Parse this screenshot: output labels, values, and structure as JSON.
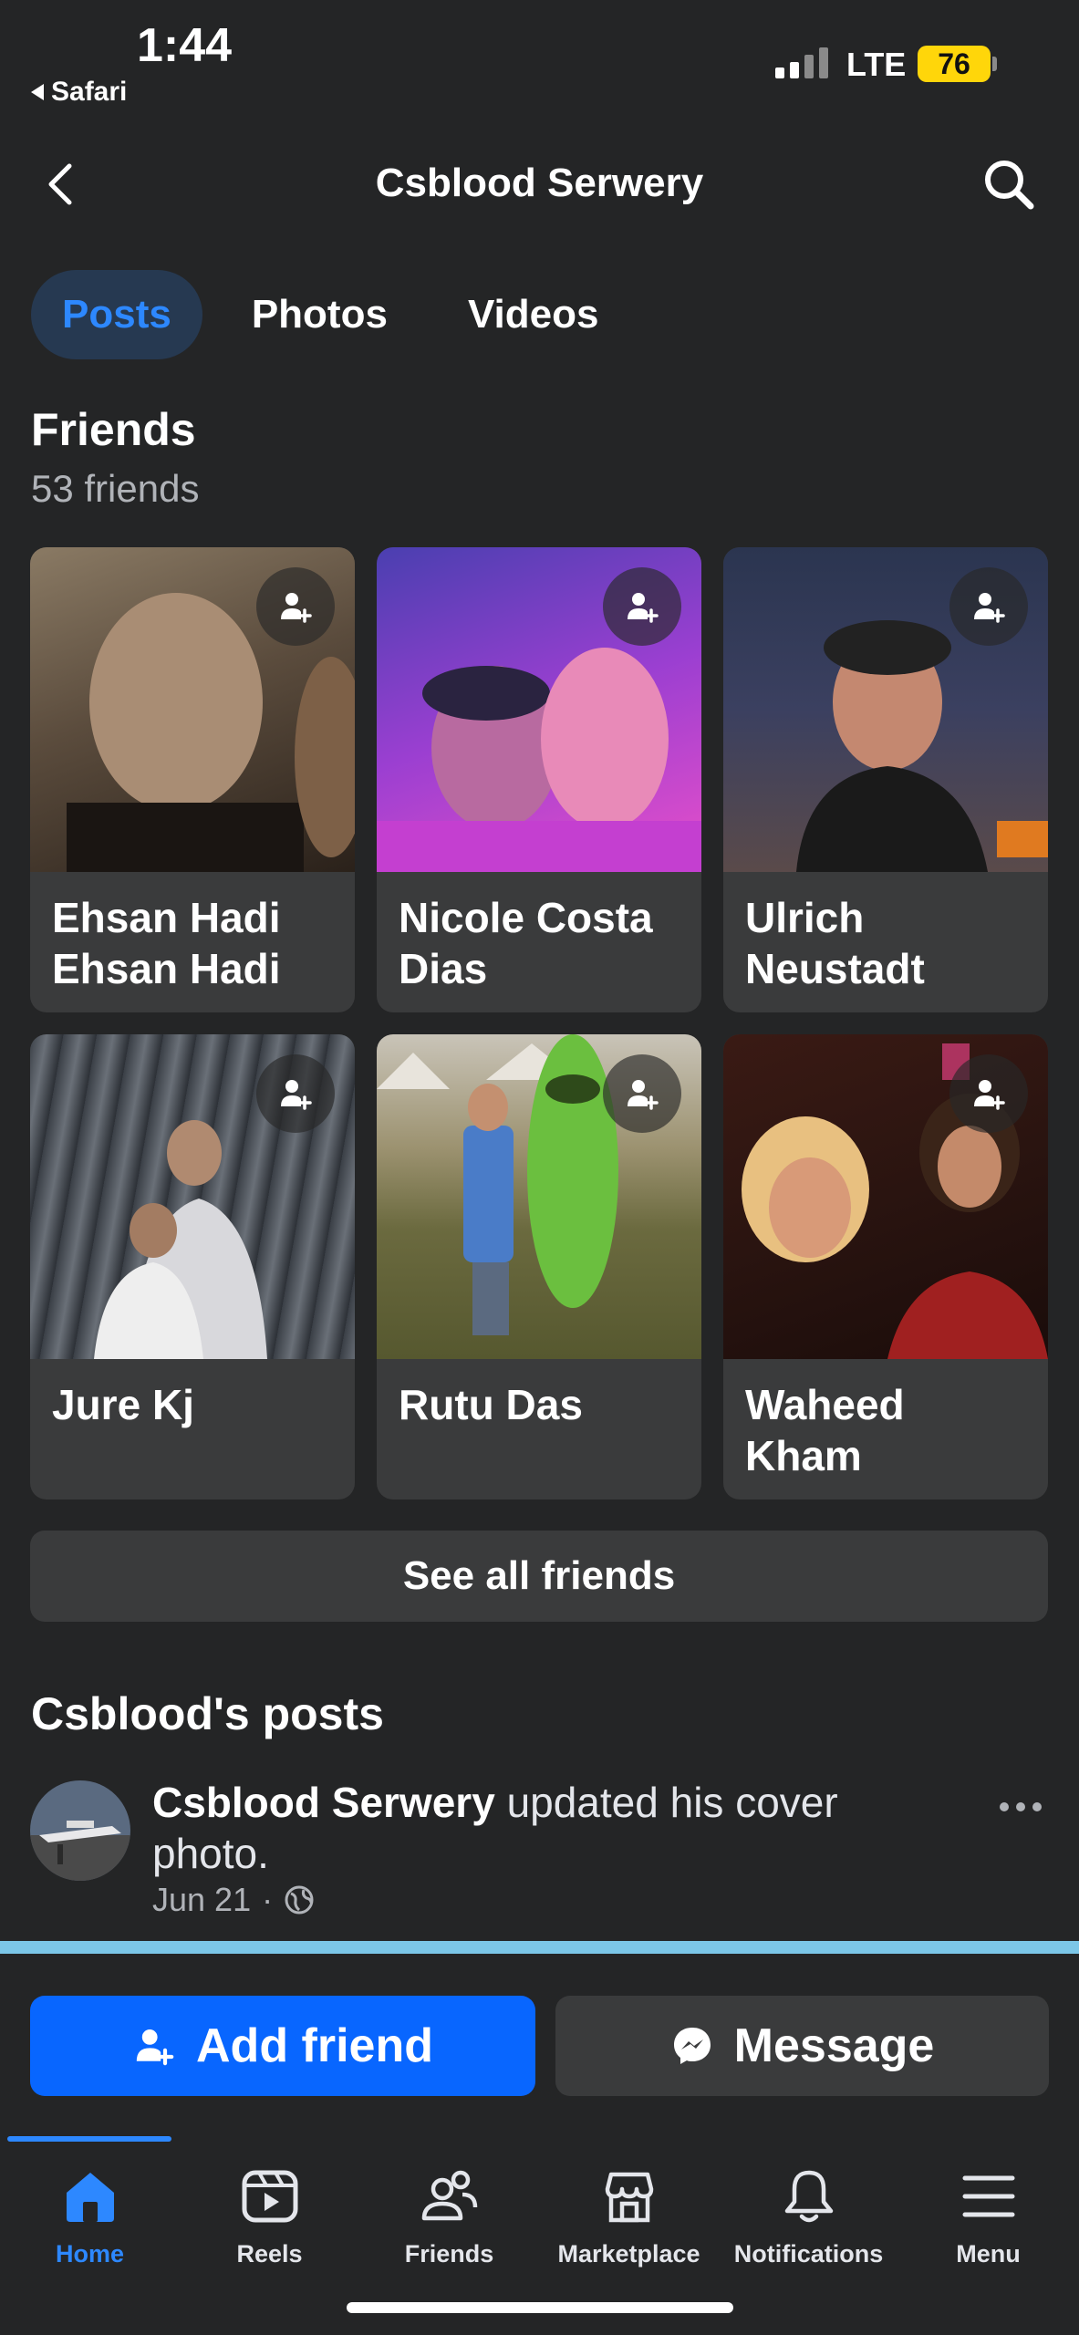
{
  "status": {
    "time": "1:44",
    "back_app": "Safari",
    "network": "LTE",
    "battery": "76"
  },
  "header": {
    "title": "Csblood Serwery"
  },
  "tabs": [
    {
      "label": "Posts",
      "active": true
    },
    {
      "label": "Photos",
      "active": false
    },
    {
      "label": "Videos",
      "active": false
    }
  ],
  "friends": {
    "title": "Friends",
    "count": "53 friends",
    "items": [
      {
        "name": "Ehsan Hadi Ehsan Hadi"
      },
      {
        "name": "Nicole Costa Dias"
      },
      {
        "name": "Ulrich Neustadt"
      },
      {
        "name": "Jure Kj"
      },
      {
        "name": "Rutu Das"
      },
      {
        "name": "Waheed Kham"
      }
    ],
    "see_all": "See all friends"
  },
  "posts": {
    "title": "Csblood's posts",
    "items": [
      {
        "author": "Csblood Serwery",
        "action": "updated his cover photo.",
        "date": "Jun 21",
        "audience_icon": "globe-icon"
      }
    ]
  },
  "actions": {
    "add_friend": "Add friend",
    "message": "Message"
  },
  "nav": [
    {
      "label": "Home",
      "icon": "home-icon",
      "active": true
    },
    {
      "label": "Reels",
      "icon": "reels-icon",
      "active": false
    },
    {
      "label": "Friends",
      "icon": "friends-icon",
      "active": false
    },
    {
      "label": "Marketplace",
      "icon": "marketplace-icon",
      "active": false
    },
    {
      "label": "Notifications",
      "icon": "bell-icon",
      "active": false
    },
    {
      "label": "Menu",
      "icon": "menu-icon",
      "active": false
    }
  ],
  "colors": {
    "background": "#242526",
    "accent": "#2d88ff",
    "primary_button": "#0866ff",
    "card": "#3a3b3c",
    "battery": "#ffd60a"
  }
}
